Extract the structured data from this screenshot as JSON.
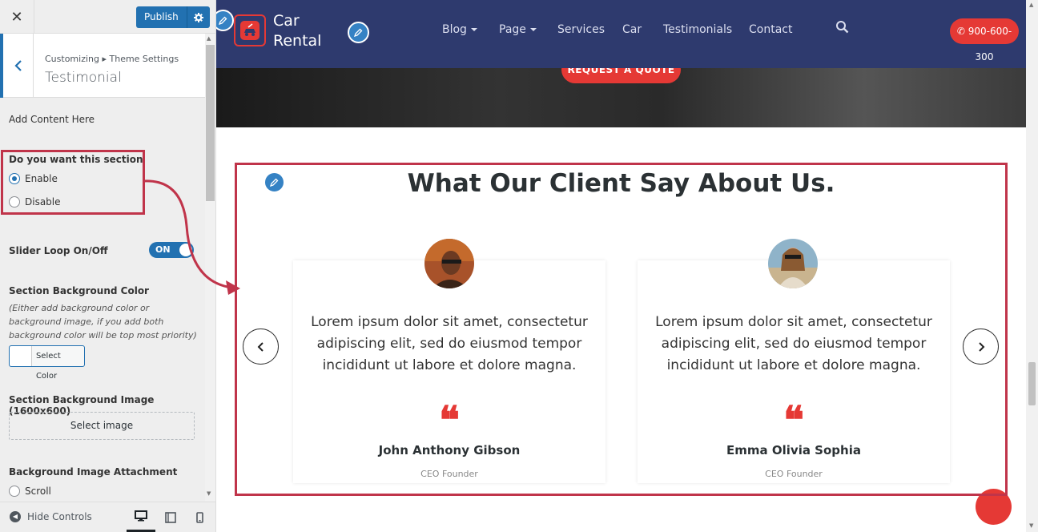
{
  "customizer": {
    "close_label": "✕",
    "publish_label": "Publish",
    "breadcrumb": "Customizing ▸ Theme Settings",
    "section_title": "Testimonial",
    "add_content_label": "Add Content Here",
    "section_toggle": {
      "label": "Do you want this section",
      "options": [
        "Enable",
        "Disable"
      ],
      "selected": "Enable"
    },
    "slider_loop": {
      "label": "Slider Loop On/Off",
      "state": "ON"
    },
    "bg_color": {
      "label": "Section Background Color",
      "help": "(Either add background color or background image, if you add both background color will be top most priority)",
      "button_label": "Select Color"
    },
    "bg_image": {
      "label": "Section Background Image (1600x600)",
      "button_label": "Select image"
    },
    "bg_attachment": {
      "label": "Background Image Attachment",
      "options": [
        "Scroll"
      ]
    },
    "footer": {
      "hide_controls_label": "Hide Controls"
    }
  },
  "site": {
    "logo_lines": [
      "Car",
      "Rental"
    ],
    "nav": [
      {
        "label": "Blog",
        "has_caret": true
      },
      {
        "label": "Page",
        "has_caret": true
      },
      {
        "label": "Services",
        "has_caret": false
      },
      {
        "label": "Car",
        "has_caret": false
      },
      {
        "label": "Testimonials",
        "has_caret": false
      },
      {
        "label": "Contact",
        "has_caret": false
      }
    ],
    "phone": "900-600-300",
    "hero_button": "REQUEST A QUOTE",
    "testimonial": {
      "title": "What Our Client Say About Us.",
      "cards": [
        {
          "text": "Lorem ipsum dolor sit amet, consectetur adipiscing elit, sed do eiusmod tempor incididunt ut labore et dolore magna.",
          "name": "John Anthony Gibson",
          "role": "CEO Founder"
        },
        {
          "text": "Lorem ipsum dolor sit amet, consectetur adipiscing elit, sed do eiusmod tempor incididunt ut labore et dolore magna.",
          "name": "Emma Olivia Sophia",
          "role": "CEO Founder"
        }
      ]
    }
  },
  "colors": {
    "accent": "#2271b1",
    "brand_red": "#e53935",
    "header_bg": "#2e3a6e",
    "annotation": "#c0344a"
  },
  "icons": [
    "close-icon",
    "gear-icon",
    "chevron-left-icon",
    "pencil-icon",
    "search-icon",
    "phone-icon",
    "chevron-right-icon",
    "quote-icon",
    "desktop-icon",
    "tablet-icon",
    "mobile-icon"
  ]
}
